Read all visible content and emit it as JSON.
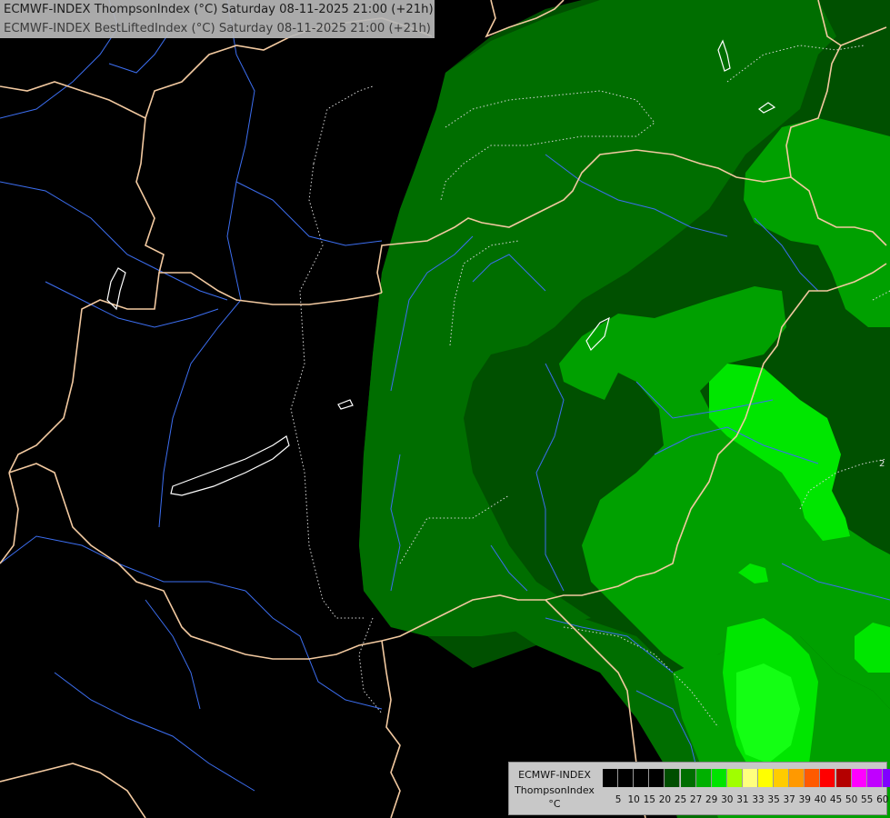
{
  "header": {
    "line1": "ECMWF-INDEX ThompsonIndex (°C) Saturday 08-11-2025 21:00 (+21h)",
    "line2": "ECMWF-INDEX BestLiftedIndex (°C) Saturday 08-11-2025 21:00 (+21h)"
  },
  "map": {
    "colors": {
      "background": "#000000",
      "green_dark": "#005000",
      "green_mid": "#006e00",
      "green_bright": "#00a000",
      "green_light": "#00e600",
      "green_vivid": "#14ff14",
      "borders": "#f2c9a0",
      "rivers": "#3c6ef0",
      "contours": "#e0e0e0"
    },
    "contour_labels": [
      "2"
    ]
  },
  "legend": {
    "title_line1": "ECMWF-INDEX",
    "title_line2": "ThompsonIndex",
    "unit": "°C",
    "ticks": [
      "5",
      "10",
      "15",
      "20",
      "25",
      "27",
      "29",
      "30",
      "31",
      "33",
      "35",
      "37",
      "39",
      "40",
      "45",
      "50",
      "55",
      "60"
    ],
    "colors": [
      "#000000",
      "#000000",
      "#000000",
      "#000000",
      "#004e00",
      "#006e00",
      "#00b000",
      "#00e400",
      "#a0ff00",
      "#ffff7e",
      "#ffff00",
      "#ffcc00",
      "#ff9900",
      "#ff5a00",
      "#ff0000",
      "#b40000",
      "#ff00ff",
      "#c000ff",
      "#8000ff",
      "#0000ff"
    ]
  }
}
